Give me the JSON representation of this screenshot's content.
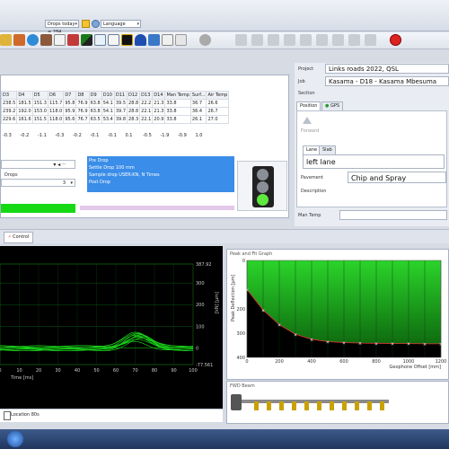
{
  "toolbar": {
    "drops_combo": "Drops today = 284",
    "language_combo": "Language"
  },
  "grid": {
    "headers": [
      "D3",
      "D4",
      "D5",
      "D6",
      "D7",
      "D8",
      "D9",
      "D10",
      "D11",
      "D12",
      "D13",
      "D14",
      "Man Temp",
      "Surf...",
      "Air Temp"
    ],
    "rows": [
      [
        "238.5",
        "181.5",
        "151.3",
        "115.7",
        "95.8",
        "76.9",
        "63.8",
        "54.1",
        "39.5",
        "28.8",
        "22.2",
        "21.3",
        "",
        "33.8",
        "36.7",
        "26.6"
      ],
      [
        "239.2",
        "192.0",
        "153.0",
        "118.0",
        "95.9",
        "76.9",
        "63.8",
        "54.1",
        "39.7",
        "28.8",
        "22.1",
        "21.3",
        "",
        "33.8",
        "36.4",
        "26.7"
      ],
      [
        "229.6",
        "161.6",
        "151.5",
        "118.0",
        "95.6",
        "76.7",
        "63.5",
        "53.4",
        "39.8",
        "28.3",
        "22.1",
        "20.9",
        "",
        "33.8",
        "26.1",
        "27.0"
      ]
    ],
    "diffs": [
      "-0.3",
      "-0.2",
      "-1.1",
      "-0.3",
      "-0.2",
      "-0.1",
      "-0.1",
      "0.1",
      "-0.5",
      "-1.9",
      "-0.9",
      "1.0"
    ]
  },
  "drops_label": "Drops",
  "drops_value": "3",
  "sequence": [
    "Pre Drop",
    "Settle Drop 100 mm",
    "Sample drop USER:KN, N Times",
    "Post Drop"
  ],
  "project": {
    "project_label": "Project",
    "project_value": "Links roads 2022, QSL",
    "job_label": "Job",
    "job_value": "Kasama - D18 - Kasama Mbesuma",
    "section_label": "Section",
    "tab_position": "Position",
    "tab_gps": "GPS",
    "forward_label": "Forward",
    "lane_tab": "Lane",
    "slab_tab": "Slab",
    "lane_value": "left lane",
    "pavement_label": "Pavement",
    "pavement_value": "Chip and Spray",
    "description_label": "Description",
    "man_temp_label": "Man Temp"
  },
  "control_tab": "Control",
  "left_chart": {
    "type": "line",
    "xlabel": "Time [ms]",
    "ylabel_right": "[kN] [µm]",
    "x_ticks": [
      "0",
      "10",
      "20",
      "30",
      "40",
      "50",
      "60",
      "70",
      "80",
      "90",
      "100"
    ],
    "y_ticks_right": [
      "387.92",
      "300",
      "200",
      "100",
      "0",
      "-77.561"
    ],
    "ylim": [
      -77.561,
      387.92
    ],
    "xlim": [
      0,
      100
    ],
    "colors": {
      "line": "#19d219",
      "grid": "#1a8a1a"
    }
  },
  "chart_data": {
    "type": "area",
    "title": "Peak and Fit Graph",
    "xlabel": "Geophone Offset [mm]",
    "ylabel": "Peak Deflection [µm]",
    "x_ticks": [
      "0",
      "200",
      "400",
      "600",
      "800",
      "1000",
      "1200"
    ],
    "y_ticks": [
      "0",
      "200",
      "300",
      "400"
    ],
    "xlim": [
      0,
      1200
    ],
    "ylim": [
      400,
      0
    ],
    "series": [
      {
        "x": [
          0,
          100,
          200,
          300,
          400,
          500,
          600,
          700,
          800,
          900,
          1000,
          1100,
          1200
        ],
        "values": [
          120,
          205,
          265,
          305,
          325,
          335,
          339,
          341,
          342,
          343,
          343,
          344,
          344
        ]
      }
    ],
    "colors": {
      "fill": "#000000",
      "line": "#e8303a",
      "band_top": "#2bd42b"
    }
  },
  "fwd_panel": {
    "title": "FWD Beam"
  },
  "bottom": {
    "location_label": "Location 80s"
  }
}
